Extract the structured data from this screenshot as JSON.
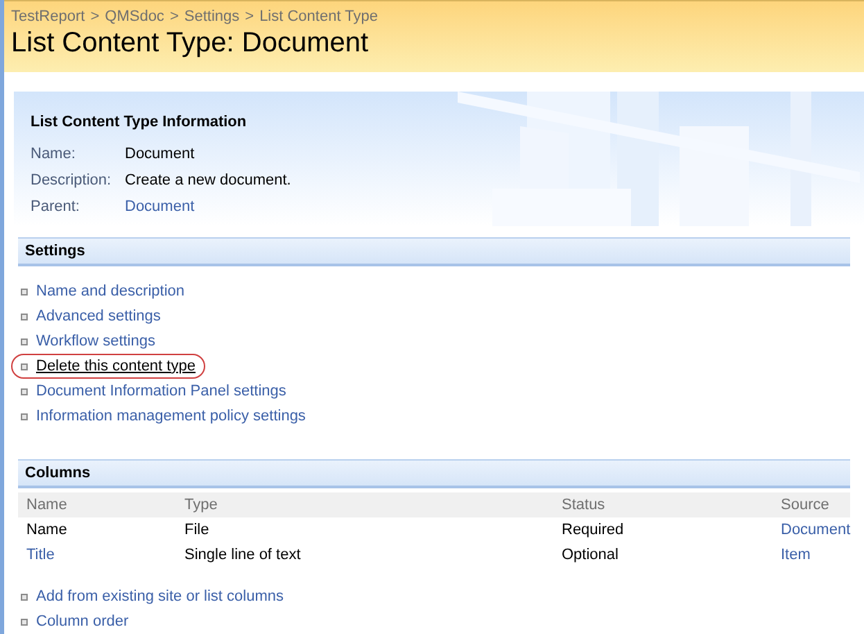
{
  "breadcrumb": [
    "TestReport",
    "QMSdoc",
    "Settings",
    "List Content Type"
  ],
  "breadcrumb_separator": ">",
  "page_title": "List Content Type: Document",
  "info": {
    "heading": "List Content Type Information",
    "fields": [
      {
        "label": "Name:",
        "value": "Document",
        "kind": "text"
      },
      {
        "label": "Description:",
        "value": "Create a new document.",
        "kind": "text"
      },
      {
        "label": "Parent:",
        "value": "Document",
        "kind": "link"
      }
    ]
  },
  "settings": {
    "heading": "Settings",
    "links": [
      {
        "label": "Name and description",
        "highlighted": false
      },
      {
        "label": "Advanced settings",
        "highlighted": false
      },
      {
        "label": "Workflow settings",
        "highlighted": false
      },
      {
        "label": "Delete this content type",
        "highlighted": true
      },
      {
        "label": "Document Information Panel settings",
        "highlighted": false
      },
      {
        "label": "Information management policy settings",
        "highlighted": false
      }
    ]
  },
  "columns": {
    "heading": "Columns",
    "table": {
      "columns": [
        "Name",
        "Type",
        "Status",
        "Source"
      ],
      "rows": [
        {
          "name": "Name",
          "name_link": false,
          "type": "File",
          "status": "Required",
          "source": "Document"
        },
        {
          "name": "Title",
          "name_link": true,
          "type": "Single line of text",
          "status": "Optional",
          "source": "Item"
        }
      ]
    },
    "links": [
      "Add from existing site or list columns",
      "Column order"
    ]
  }
}
